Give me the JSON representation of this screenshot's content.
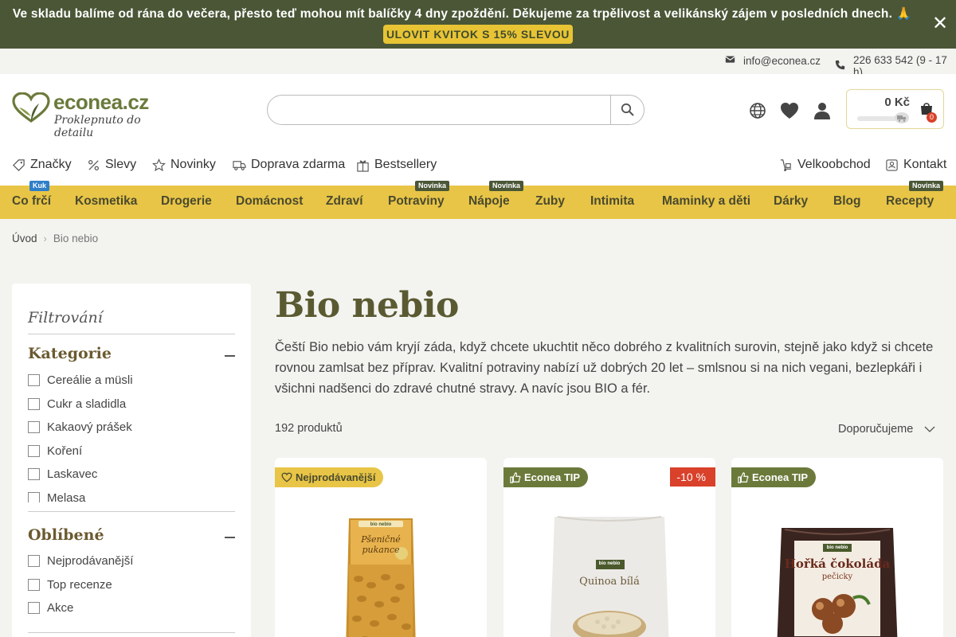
{
  "announcement": {
    "text": "Ve skladu balíme od rána do večera, přesto teď mohou mít balíčky 4 dny zpoždění. Děkujeme za trpělivost a velikánský zájem v posledních dnech. 🙏",
    "cta": "ULOVIT KVITOK S 15% SLEVOU",
    "close": "✕"
  },
  "contact": {
    "email": "info@econea.cz",
    "phone": "226 633 542 (9 - 17 h)"
  },
  "logo": {
    "name": "econea.cz",
    "tagline": "Proklepnuto do detailu"
  },
  "search": {
    "placeholder": "",
    "value": ""
  },
  "cart": {
    "price": "0 Kč",
    "count": "0"
  },
  "subnav": {
    "left": [
      "Značky",
      "Slevy",
      "Novinky",
      "Doprava zdarma",
      "Bestsellery"
    ],
    "right": [
      "Velkoobchod",
      "Kontakt"
    ]
  },
  "categories": [
    {
      "label": "Co frčí",
      "badge": "Kuk"
    },
    {
      "label": "Kosmetika",
      "badge": ""
    },
    {
      "label": "Drogerie",
      "badge": ""
    },
    {
      "label": "Domácnost",
      "badge": ""
    },
    {
      "label": "Zdraví",
      "badge": ""
    },
    {
      "label": "Potraviny",
      "badge": "Novinka"
    },
    {
      "label": "Nápoje",
      "badge": "Novinka"
    },
    {
      "label": "Zuby",
      "badge": ""
    },
    {
      "label": "Intimita",
      "badge": ""
    },
    {
      "label": "Maminky a děti",
      "badge": ""
    },
    {
      "label": "Dárky",
      "badge": ""
    },
    {
      "label": "Blog",
      "badge": ""
    },
    {
      "label": "Recepty",
      "badge": "Novinka"
    }
  ],
  "breadcrumb": {
    "home": "Úvod",
    "current": "Bio nebio"
  },
  "filter": {
    "title": "Filtrování",
    "sections": [
      {
        "title": "Kategorie",
        "options": [
          "Cereálie a müsli",
          "Cukr a sladidla",
          "Kakaový prášek",
          "Koření",
          "Laskavec",
          "Melasa"
        ]
      },
      {
        "title": "Oblíbené",
        "options": [
          "Nejprodávanější",
          "Top recenze",
          "Akce"
        ]
      }
    ]
  },
  "main": {
    "title": "Bio nebio",
    "description": "Čeští Bio nebio vám kryjí záda, když chcete ukuchtit něco dobrého z kvalitních surovin, stejně jako když si chcete rovnou zamlsat bez příprav. Kvalitní potraviny nabízí už dobrých 20 let – smlsnou si na nich vegani, bezlepkáři i všichni nadšenci do zdravé chutné stravy. A navíc jsou BIO a fér.",
    "product_count": "192 produktů",
    "sort": "Doporučujeme"
  },
  "products": [
    {
      "badge": "Nejprodávanější",
      "discount": "",
      "brand": "bio nebio",
      "name": "Pšeničné pukance"
    },
    {
      "badge": "Econea TIP",
      "discount": "-10 %",
      "brand": "bio nebio",
      "name": "Quinoa bílá"
    },
    {
      "badge": "Econea TIP",
      "discount": "",
      "brand": "bio nebio",
      "name": "Hořká čokoláda",
      "subname": "pečicky"
    }
  ],
  "colors": {
    "announce_bg": "#4a5636",
    "accent_yellow": "#e8c547",
    "brand_green": "#6b7a3a",
    "discount_red": "#d9412a"
  }
}
